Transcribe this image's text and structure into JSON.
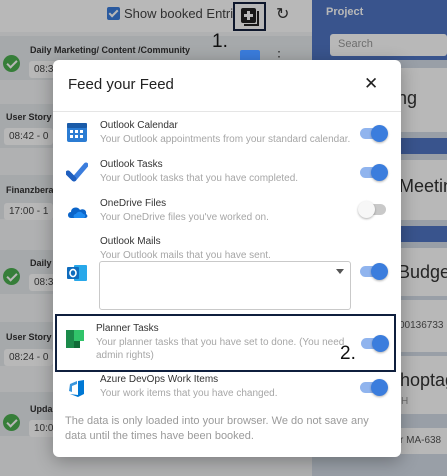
{
  "app": {
    "show_booked_label": "Show booked Entries",
    "project_label": "Project",
    "search_placeholder": "Search",
    "step1": "1.",
    "step2": "2.",
    "entries": [
      {
        "title": "Daily Marketing/ Content /Community",
        "time": "08:3"
      },
      {
        "title": "User Story",
        "time": "08:42 - 0"
      },
      {
        "title": "Finanzbera",
        "time": "17:00 - 1"
      },
      {
        "title": "Daily",
        "time": "08:3"
      },
      {
        "title": "User Story",
        "time": "08:24 - 0"
      },
      {
        "title": "Upda",
        "time": "10:0"
      }
    ],
    "projects": [
      {
        "title": "ng",
        "sub": ""
      },
      {
        "title": "Meetin",
        "sub": ""
      },
      {
        "title": "Budget",
        "sub": ""
      },
      {
        "title": "",
        "sub": "00136733"
      },
      {
        "title": "hoptag",
        "sub": "H"
      },
      {
        "title": "",
        "sub": "r MA-638"
      }
    ]
  },
  "modal": {
    "title": "Feed your Feed",
    "close_glyph": "✕",
    "items": [
      {
        "title": "Outlook Calendar",
        "desc": [
          "Your Outlook appointments from your standard calendar."
        ],
        "icon": "outlook-calendar-icon",
        "enabled": true
      },
      {
        "title": "Outlook Tasks",
        "desc": [
          "Your Outlook tasks that you have completed."
        ],
        "icon": "outlook-tasks-icon",
        "enabled": true
      },
      {
        "title": "OneDrive Files",
        "desc": [
          "Your OneDrive files you've worked on."
        ],
        "icon": "onedrive-icon",
        "enabled": false
      },
      {
        "title": "Outlook Mails",
        "desc": [
          "Your Outlook mails that you have sent."
        ],
        "icon": "outlook-mail-icon",
        "enabled": true
      },
      {
        "title": "Planner Tasks",
        "desc": [
          "Your planner tasks that you have set to done. (You need",
          "admin rights)"
        ],
        "icon": "planner-icon",
        "enabled": true
      },
      {
        "title": "Azure DevOps Work Items",
        "desc": [
          "Your work items that you have changed."
        ],
        "icon": "azure-devops-icon",
        "enabled": true
      }
    ],
    "footnote": "The data is only loaded into your browser. We do not save any data until the times have been booked."
  },
  "colors": {
    "accent": "#3b7ddd",
    "toggle_track_on": "#90b4ee",
    "annotation_border": "#0f1f3d",
    "success": "#4caf50"
  }
}
